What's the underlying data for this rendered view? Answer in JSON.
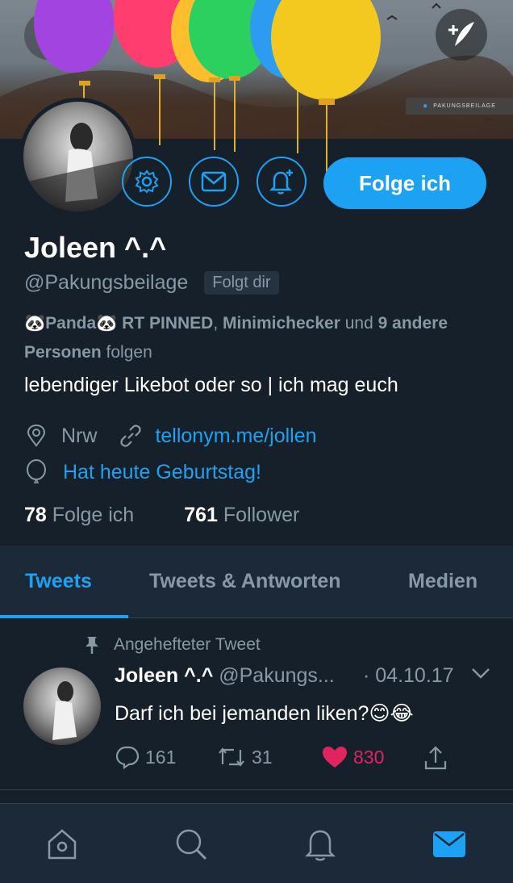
{
  "colors": {
    "background": "#15202b",
    "panel": "#1c2938",
    "accent": "#1da1f2",
    "muted": "#8899a6",
    "like": "#e0245e"
  },
  "header": {
    "banner_tag": "PAKUNGSBEILAGE",
    "back_icon": "chevron-left-icon",
    "compose_icon": "quill-plus-icon"
  },
  "profile": {
    "actions": {
      "settings_icon": "gear-icon",
      "message_icon": "mail-icon",
      "notify_icon": "bell-plus-icon",
      "follow_label": "Folge ich"
    },
    "name": "Joleen ^.^",
    "handle": "@Pakungsbeilage",
    "follows_you": "Folgt dir",
    "known_followers": {
      "part1": "🐼Panda🐼 RT PINNED",
      "sep": ", ",
      "part2": "Minimichecker",
      "mid": " und ",
      "part3": "9 andere Personen",
      "end": " folgen"
    },
    "bio": "lebendiger Likebot oder so | ich mag euch",
    "location": "Nrw",
    "website": "tellonym.me/jollen",
    "birthday": "Hat heute Geburtstag!",
    "following_count": "78",
    "following_label": "Folge ich",
    "followers_count": "761",
    "followers_label": "Follower"
  },
  "tabs": [
    {
      "label": "Tweets",
      "active": true
    },
    {
      "label": "Tweets & Antworten",
      "active": false
    },
    {
      "label": "Medien",
      "active": false
    }
  ],
  "tweet": {
    "pinned_label": "Angehefteter Tweet",
    "author_name": "Joleen ^.^",
    "author_handle": "@Pakungs...",
    "date": "· 04.10.17",
    "text": "Darf ich bei jemanden liken?😊😂",
    "replies": "161",
    "retweets": "31",
    "likes": "830"
  },
  "bottom_nav": [
    {
      "icon": "home-icon",
      "active": false
    },
    {
      "icon": "search-icon",
      "active": false
    },
    {
      "icon": "notifications-icon",
      "active": false
    },
    {
      "icon": "messages-icon",
      "active": true
    }
  ]
}
